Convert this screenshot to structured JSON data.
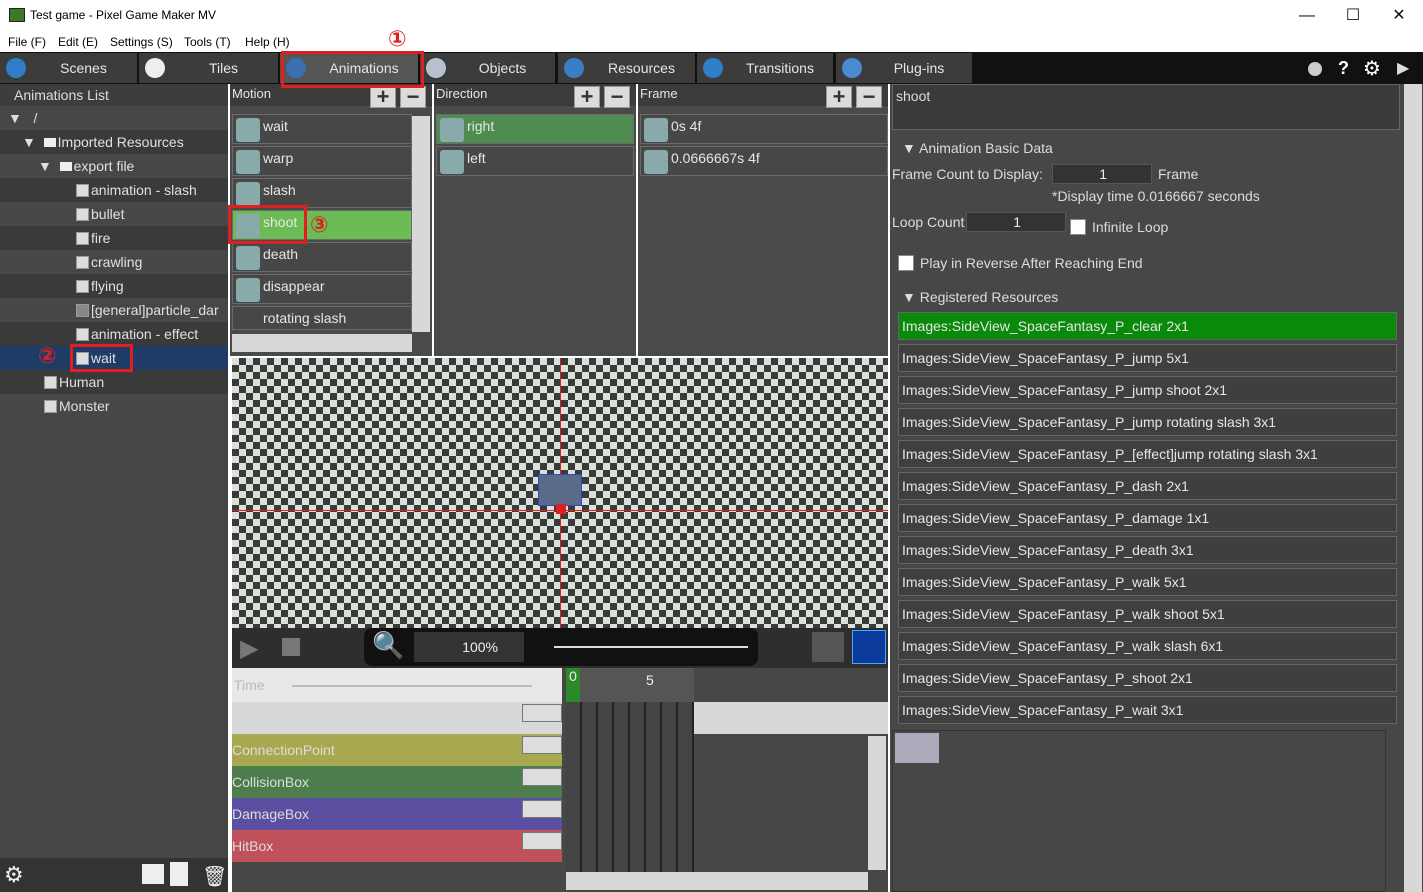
{
  "window": {
    "title": "Test game - Pixel Game Maker MV",
    "minimize": "—",
    "maximize": "☐",
    "close": "✕"
  },
  "menu": [
    "File (F)",
    "Edit (E)",
    "Settings (S)",
    "Tools (T)",
    "Help (H)"
  ],
  "tabs": [
    {
      "label": "Scenes",
      "icon": "scenes-icon"
    },
    {
      "label": "Tiles",
      "icon": "tiles-icon"
    },
    {
      "label": "Animations",
      "icon": "animations-icon"
    },
    {
      "label": "Objects",
      "icon": "objects-icon"
    },
    {
      "label": "Resources",
      "icon": "resources-icon"
    },
    {
      "label": "Transitions",
      "icon": "transitions-icon"
    },
    {
      "label": "Plug-ins",
      "icon": "plugins-icon"
    }
  ],
  "toolbar_right": {
    "help": "?",
    "play": "▶"
  },
  "left": {
    "header": "Animations List",
    "root": "/",
    "items": [
      {
        "label": "Imported Resources"
      },
      {
        "label": "export file"
      },
      {
        "label": "animation - slash"
      },
      {
        "label": "bullet"
      },
      {
        "label": "fire"
      },
      {
        "label": "crawling"
      },
      {
        "label": "flying"
      },
      {
        "label": "[general]particle_dar"
      },
      {
        "label": "animation - effect"
      },
      {
        "label": "wait"
      },
      {
        "label": "Human"
      },
      {
        "label": "Monster"
      }
    ]
  },
  "motion": {
    "header": "Motion",
    "items": [
      "wait",
      "warp",
      "slash",
      "shoot",
      "death",
      "disappear",
      "rotating slash"
    ]
  },
  "direction": {
    "header": "Direction",
    "items": [
      "right",
      "left"
    ]
  },
  "frame": {
    "header": "Frame",
    "items": [
      "0s 4f",
      "0.0666667s 4f"
    ]
  },
  "playbar": {
    "zoom": "100%"
  },
  "timeline": {
    "time_label": "Time",
    "ruler": [
      "0",
      "5"
    ],
    "tracks": [
      {
        "name": "ConnectionPoint",
        "color": "#a8a850"
      },
      {
        "name": "CollisionBox",
        "color": "#4d7d4d"
      },
      {
        "name": "DamageBox",
        "color": "#5a4fa0"
      },
      {
        "name": "HitBox",
        "color": "#c0505a"
      }
    ]
  },
  "right": {
    "name_value": "shoot",
    "basic_header": "Animation Basic Data",
    "frame_count_label": "Frame Count to Display:",
    "frame_count_value": "1",
    "frame_unit": "Frame",
    "display_time": "*Display time 0.0166667 seconds",
    "loop_label": "Loop Count",
    "loop_value": "1",
    "infinite_loop": "Infinite Loop",
    "reverse_label": "Play in Reverse After Reaching End",
    "registered_header": "Registered Resources",
    "resources": [
      "Images:SideView_SpaceFantasy_P_clear 2x1",
      "Images:SideView_SpaceFantasy_P_jump 5x1",
      "Images:SideView_SpaceFantasy_P_jump shoot 2x1",
      "Images:SideView_SpaceFantasy_P_jump rotating slash 3x1",
      "Images:SideView_SpaceFantasy_P_[effect]jump rotating slash 3x1",
      "Images:SideView_SpaceFantasy_P_dash 2x1",
      "Images:SideView_SpaceFantasy_P_damage 1x1",
      "Images:SideView_SpaceFantasy_P_death 3x1",
      "Images:SideView_SpaceFantasy_P_walk 5x1",
      "Images:SideView_SpaceFantasy_P_walk shoot 5x1",
      "Images:SideView_SpaceFantasy_P_walk slash 6x1",
      "Images:SideView_SpaceFantasy_P_shoot 2x1",
      "Images:SideView_SpaceFantasy_P_wait 3x1"
    ]
  },
  "annotations": [
    "①",
    "②",
    "③"
  ],
  "colors": {
    "accent_green": "#6bbc55",
    "selected_resource": "#0a8a0a",
    "highlight": "#e02020"
  }
}
